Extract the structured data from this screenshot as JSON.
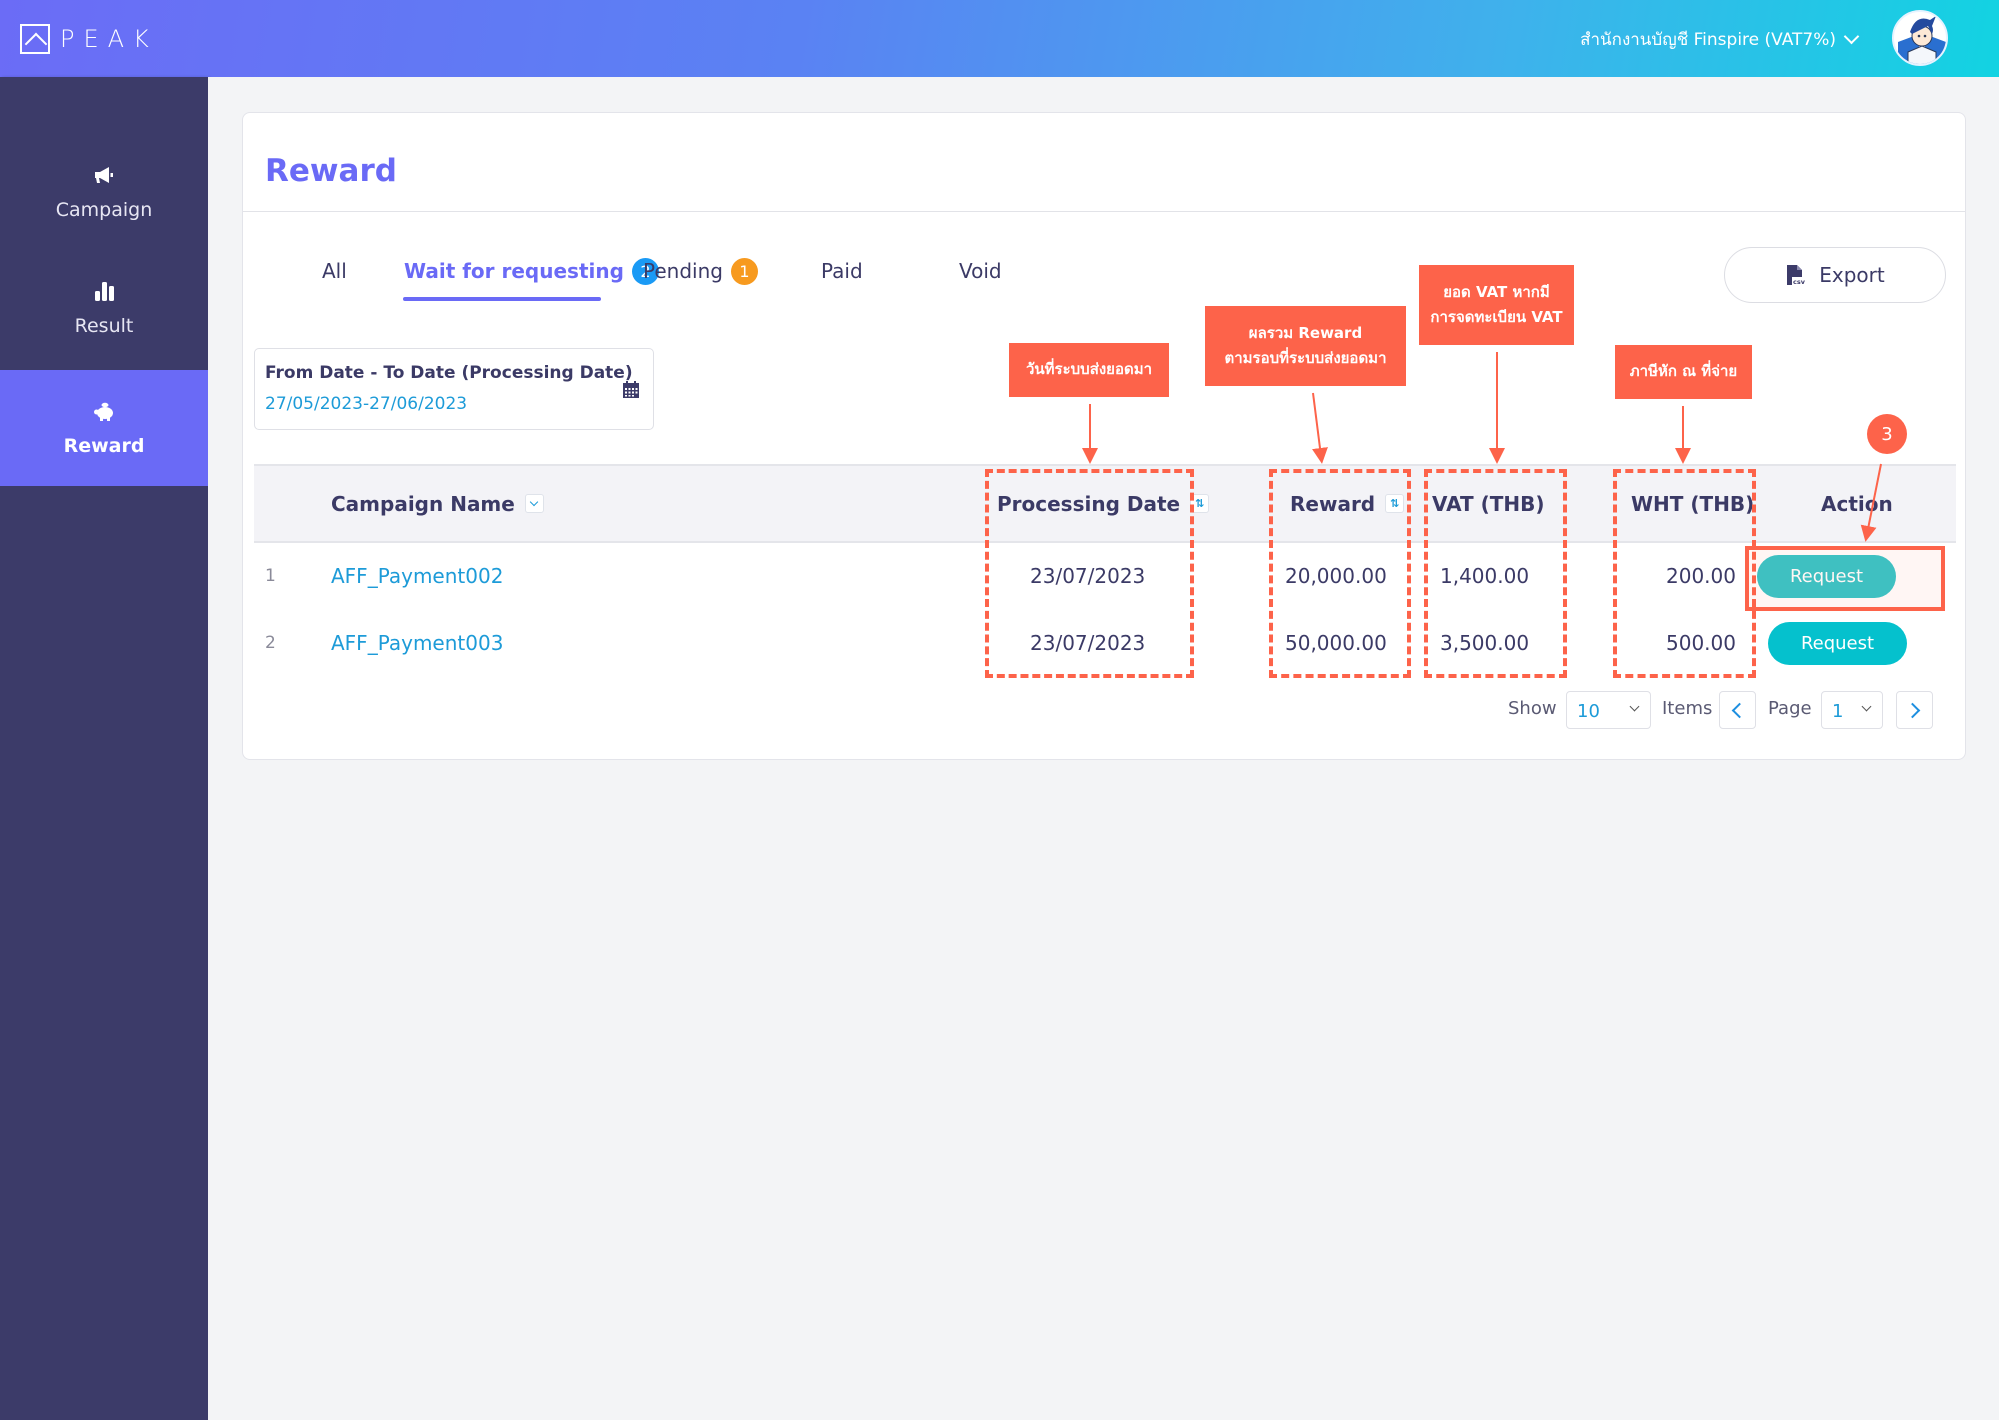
{
  "header": {
    "logo_text": "PEAK",
    "organization": "สำนักงานบัญชี Finspire (VAT7%)",
    "colors": {
      "gradient_start": "#6b6cf6",
      "gradient_end": "#12d3e2"
    }
  },
  "sidebar": {
    "items": [
      {
        "label": "Campaign",
        "icon": "megaphone-icon",
        "active": false
      },
      {
        "label": "Result",
        "icon": "bar-chart-icon",
        "active": false
      },
      {
        "label": "Reward",
        "icon": "piggy-bank-icon",
        "active": true
      }
    ],
    "colors": {
      "background": "#3c3b69",
      "active": "#6a6af6"
    }
  },
  "page": {
    "title": "Reward",
    "tabs": [
      {
        "label": "All",
        "active": false
      },
      {
        "label": "Wait for requesting",
        "badge": "2",
        "active": true
      },
      {
        "label": "Pending",
        "badge": "1",
        "active": false
      },
      {
        "label": "Paid",
        "active": false
      },
      {
        "label": "Void",
        "active": false
      }
    ],
    "export_label": "Export",
    "export_icon": "csv-file-icon",
    "date_filter": {
      "label": "From Date - To Date (Processing Date)",
      "value": "27/05/2023-27/06/2023"
    }
  },
  "table": {
    "columns": [
      "",
      "Campaign Name",
      "Processing Date",
      "Reward",
      "VAT (THB)",
      "WHT (THB)",
      "Action"
    ],
    "rows": [
      {
        "index": "1",
        "campaign": "AFF_Payment002",
        "processing_date": "23/07/2023",
        "reward": "20,000.00",
        "vat": "1,400.00",
        "wht": "200.00",
        "action": "Request"
      },
      {
        "index": "2",
        "campaign": "AFF_Payment003",
        "processing_date": "23/07/2023",
        "reward": "50,000.00",
        "vat": "3,500.00",
        "wht": "500.00",
        "action": "Request"
      }
    ]
  },
  "pagination": {
    "show_label": "Show",
    "page_size": "10",
    "items_label": "Items",
    "page_label": "Page",
    "current_page": "1"
  },
  "annotations": {
    "processing_date_note": "วันที่ระบบส่งยอดมา",
    "reward_note_line1": "ผลรวม Reward",
    "reward_note_line2": "ตามรอบที่ระบบส่งยอดมา",
    "vat_note_line1": "ยอด VAT หากมี",
    "vat_note_line2": "การจดทะเบียน VAT",
    "wht_note": "ภาษีหัก ณ ที่จ่าย",
    "step_number": "3",
    "color": "#fd634a"
  }
}
